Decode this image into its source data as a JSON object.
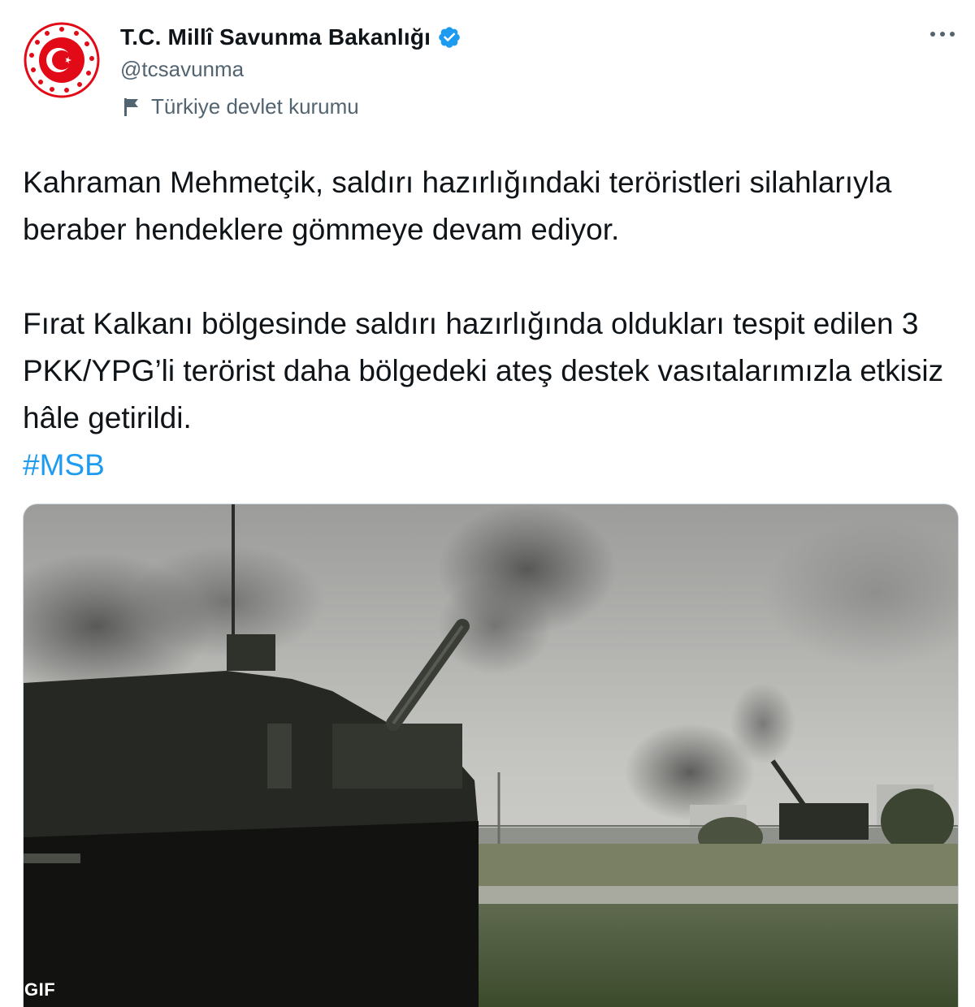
{
  "account": {
    "display_name": "T.C. Millî Savunma Bakanlığı",
    "handle": "@tcsavunma",
    "label": "Türkiye devlet kurumu",
    "verified": true
  },
  "tweet": {
    "paragraph1": "Kahraman Mehmetçik, saldırı hazırlığındaki teröristleri silahlarıyla beraber hendeklere gömmeye devam ediyor.",
    "paragraph2": "Fırat Kalkanı bölgesinde saldırı hazırlığında oldukları tespit edilen 3 PKK/YPG’li terörist daha bölgedeki ateş destek vasıtalarımızla etkisiz hâle getirildi.",
    "hashtag": "#MSB"
  },
  "media": {
    "type_badge": "GIF"
  },
  "icons": {
    "verified": "verified-badge-icon",
    "label": "flag-icon",
    "more": "more-options-icon"
  },
  "colors": {
    "accent": "#1d9bf0",
    "secondary_text": "#536471",
    "avatar_red": "#e30a17"
  }
}
